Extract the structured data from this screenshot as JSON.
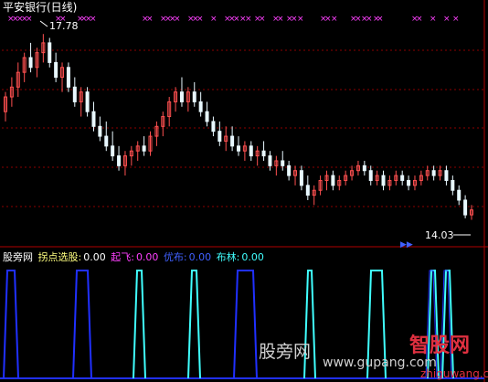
{
  "title": "平安银行(日线)",
  "price_labels": {
    "high": "17.78",
    "low": "14.03"
  },
  "indicator_bar": {
    "source": "股旁网",
    "items": [
      {
        "label": "拐点选股:",
        "value": "0.00",
        "color": "#ffffff"
      },
      {
        "label": "起飞:",
        "value": "0.00",
        "color": "#ff40ff"
      },
      {
        "label": "优布:",
        "value": "0.00",
        "color": "#4060ff"
      },
      {
        "label": "布林:",
        "value": "0.00",
        "color": "#40ffff"
      }
    ]
  },
  "watermark": {
    "cn": "股旁网",
    "url": "www.gupang.com",
    "brand": "智股网",
    "brand_url": "zhiguwang.com"
  },
  "colors": {
    "up": "#ff5050",
    "down": "#e8f8ff",
    "grid": "#8b0000",
    "blue": "#2030ff",
    "cyan": "#40ffff",
    "marker": "#ff40ff"
  },
  "chart_data": [
    {
      "type": "candlestick",
      "ylim": [
        13.6,
        18.1
      ],
      "markers_top": 38,
      "candles": [
        [
          16.2,
          16.6,
          16.0,
          16.5
        ],
        [
          16.5,
          16.9,
          16.3,
          16.7
        ],
        [
          16.7,
          17.2,
          16.5,
          17.0
        ],
        [
          17.0,
          17.4,
          16.8,
          17.3
        ],
        [
          17.3,
          17.6,
          17.0,
          17.1
        ],
        [
          17.1,
          17.5,
          16.9,
          17.4
        ],
        [
          17.4,
          17.78,
          17.2,
          17.6
        ],
        [
          17.6,
          17.7,
          17.1,
          17.2
        ],
        [
          17.2,
          17.4,
          16.8,
          16.9
        ],
        [
          16.9,
          17.2,
          16.6,
          17.1
        ],
        [
          17.1,
          17.2,
          16.6,
          16.7
        ],
        [
          16.7,
          16.9,
          16.3,
          16.4
        ],
        [
          16.4,
          16.7,
          16.1,
          16.6
        ],
        [
          16.6,
          16.7,
          16.1,
          16.2
        ],
        [
          16.2,
          16.4,
          15.8,
          15.9
        ],
        [
          15.9,
          16.1,
          15.6,
          15.7
        ],
        [
          15.7,
          16.0,
          15.4,
          15.5
        ],
        [
          15.5,
          15.8,
          15.2,
          15.3
        ],
        [
          15.3,
          15.5,
          15.0,
          15.1
        ],
        [
          15.1,
          15.4,
          14.9,
          15.3
        ],
        [
          15.3,
          15.5,
          15.1,
          15.4
        ],
        [
          15.4,
          15.6,
          15.2,
          15.5
        ],
        [
          15.5,
          15.7,
          15.3,
          15.4
        ],
        [
          15.4,
          15.8,
          15.3,
          15.7
        ],
        [
          15.7,
          16.0,
          15.5,
          15.9
        ],
        [
          15.9,
          16.2,
          15.7,
          16.1
        ],
        [
          16.1,
          16.5,
          15.9,
          16.4
        ],
        [
          16.4,
          16.7,
          16.2,
          16.6
        ],
        [
          16.6,
          16.9,
          16.3,
          16.4
        ],
        [
          16.4,
          16.7,
          16.2,
          16.6
        ],
        [
          16.6,
          16.8,
          16.3,
          16.4
        ],
        [
          16.4,
          16.6,
          16.1,
          16.2
        ],
        [
          16.2,
          16.4,
          15.9,
          16.0
        ],
        [
          16.0,
          16.1,
          15.7,
          15.8
        ],
        [
          15.8,
          16.0,
          15.5,
          15.6
        ],
        [
          15.6,
          15.9,
          15.4,
          15.7
        ],
        [
          15.7,
          15.9,
          15.4,
          15.5
        ],
        [
          15.5,
          15.7,
          15.3,
          15.4
        ],
        [
          15.4,
          15.6,
          15.2,
          15.5
        ],
        [
          15.5,
          15.6,
          15.2,
          15.3
        ],
        [
          15.3,
          15.5,
          15.1,
          15.4
        ],
        [
          15.4,
          15.6,
          15.2,
          15.3
        ],
        [
          15.3,
          15.4,
          15.0,
          15.1
        ],
        [
          15.1,
          15.3,
          14.9,
          15.2
        ],
        [
          15.2,
          15.4,
          15.0,
          15.1
        ],
        [
          15.1,
          15.2,
          14.8,
          14.9
        ],
        [
          14.9,
          15.1,
          14.7,
          15.0
        ],
        [
          15.0,
          15.1,
          14.6,
          14.7
        ],
        [
          14.7,
          14.9,
          14.4,
          14.5
        ],
        [
          14.5,
          14.7,
          14.3,
          14.6
        ],
        [
          14.6,
          14.9,
          14.5,
          14.8
        ],
        [
          14.8,
          15.0,
          14.6,
          14.9
        ],
        [
          14.9,
          15.0,
          14.6,
          14.7
        ],
        [
          14.7,
          14.9,
          14.6,
          14.8
        ],
        [
          14.8,
          15.0,
          14.7,
          14.9
        ],
        [
          14.9,
          15.1,
          14.8,
          15.0
        ],
        [
          15.0,
          15.2,
          14.9,
          15.1
        ],
        [
          15.1,
          15.2,
          14.9,
          15.0
        ],
        [
          15.0,
          15.1,
          14.7,
          14.8
        ],
        [
          14.8,
          15.0,
          14.7,
          14.9
        ],
        [
          14.9,
          15.0,
          14.6,
          14.7
        ],
        [
          14.7,
          14.9,
          14.6,
          14.8
        ],
        [
          14.8,
          15.0,
          14.7,
          14.9
        ],
        [
          14.9,
          15.0,
          14.7,
          14.8
        ],
        [
          14.8,
          14.9,
          14.6,
          14.7
        ],
        [
          14.7,
          14.9,
          14.6,
          14.8
        ],
        [
          14.8,
          15.0,
          14.7,
          14.9
        ],
        [
          14.9,
          15.1,
          14.8,
          15.0
        ],
        [
          15.0,
          15.1,
          14.8,
          14.9
        ],
        [
          14.9,
          15.1,
          14.8,
          15.0
        ],
        [
          15.0,
          15.1,
          14.7,
          14.8
        ],
        [
          14.8,
          14.9,
          14.5,
          14.6
        ],
        [
          14.6,
          14.7,
          14.3,
          14.4
        ],
        [
          14.4,
          14.5,
          14.03,
          14.1
        ],
        [
          14.1,
          14.3,
          14.0,
          14.2
        ]
      ]
    }
  ]
}
